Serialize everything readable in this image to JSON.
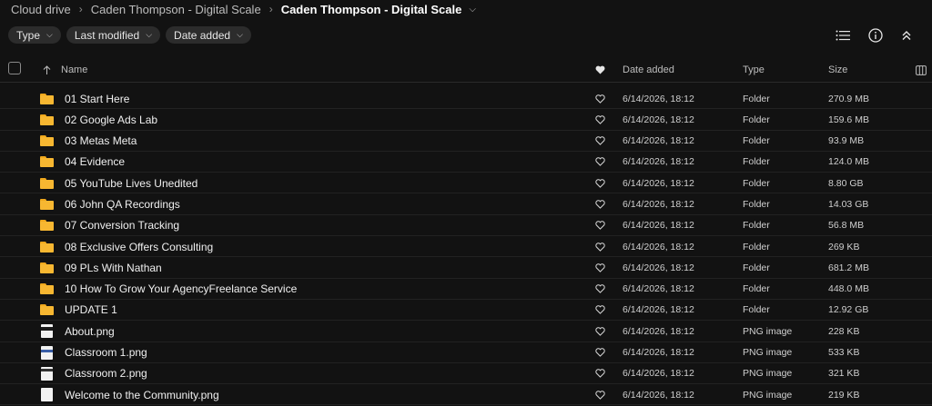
{
  "breadcrumb": {
    "items": [
      "Cloud drive",
      "Caden Thompson - Digital Scale",
      "Caden Thompson - Digital Scale"
    ]
  },
  "filters": {
    "type_label": "Type",
    "last_modified_label": "Last modified",
    "date_added_label": "Date added"
  },
  "columns": {
    "name": "Name",
    "date_added": "Date added",
    "type": "Type",
    "size": "Size"
  },
  "rows": [
    {
      "icon": "folder-icon",
      "name": "01 Start Here",
      "date": "6/14/2026, 18:12",
      "type": "Folder",
      "size": "270.9 MB"
    },
    {
      "icon": "folder-icon",
      "name": "02 Google Ads Lab",
      "date": "6/14/2026, 18:12",
      "type": "Folder",
      "size": "159.6 MB"
    },
    {
      "icon": "folder-icon",
      "name": "03 Metas Meta",
      "date": "6/14/2026, 18:12",
      "type": "Folder",
      "size": "93.9 MB"
    },
    {
      "icon": "folder-icon",
      "name": "04 Evidence",
      "date": "6/14/2026, 18:12",
      "type": "Folder",
      "size": "124.0 MB"
    },
    {
      "icon": "folder-icon",
      "name": "05 YouTube Lives Unedited",
      "date": "6/14/2026, 18:12",
      "type": "Folder",
      "size": "8.80 GB"
    },
    {
      "icon": "folder-icon",
      "name": "06 John QA Recordings",
      "date": "6/14/2026, 18:12",
      "type": "Folder",
      "size": "14.03 GB"
    },
    {
      "icon": "folder-icon",
      "name": "07 Conversion Tracking",
      "date": "6/14/2026, 18:12",
      "type": "Folder",
      "size": "56.8 MB"
    },
    {
      "icon": "folder-icon",
      "name": "08 Exclusive Offers Consulting",
      "date": "6/14/2026, 18:12",
      "type": "Folder",
      "size": "269 KB"
    },
    {
      "icon": "folder-icon",
      "name": "09 PLs With Nathan",
      "date": "6/14/2026, 18:12",
      "type": "Folder",
      "size": "681.2 MB"
    },
    {
      "icon": "folder-icon",
      "name": "10 How To Grow Your AgencyFreelance Service",
      "date": "6/14/2026, 18:12",
      "type": "Folder",
      "size": "448.0 MB"
    },
    {
      "icon": "folder-icon",
      "name": "UPDATE 1",
      "date": "6/14/2026, 18:12",
      "type": "Folder",
      "size": "12.92 GB"
    },
    {
      "icon": "image-file-icon",
      "name": "About.png",
      "date": "6/14/2026, 18:12",
      "type": "PNG image",
      "size": "228 KB"
    },
    {
      "icon": "image-file-icon",
      "name": "Classroom 1.png",
      "date": "6/14/2026, 18:12",
      "type": "PNG image",
      "size": "533 KB"
    },
    {
      "icon": "image-file-icon",
      "name": "Classroom 2.png",
      "date": "6/14/2026, 18:12",
      "type": "PNG image",
      "size": "321 KB"
    },
    {
      "icon": "image-file-icon",
      "name": "Welcome to the Community.png",
      "date": "6/14/2026, 18:12",
      "type": "PNG image",
      "size": "219 KB"
    }
  ],
  "colors": {
    "background": "#121212",
    "folder": "#f7b731",
    "chip": "#2c2c2c"
  }
}
